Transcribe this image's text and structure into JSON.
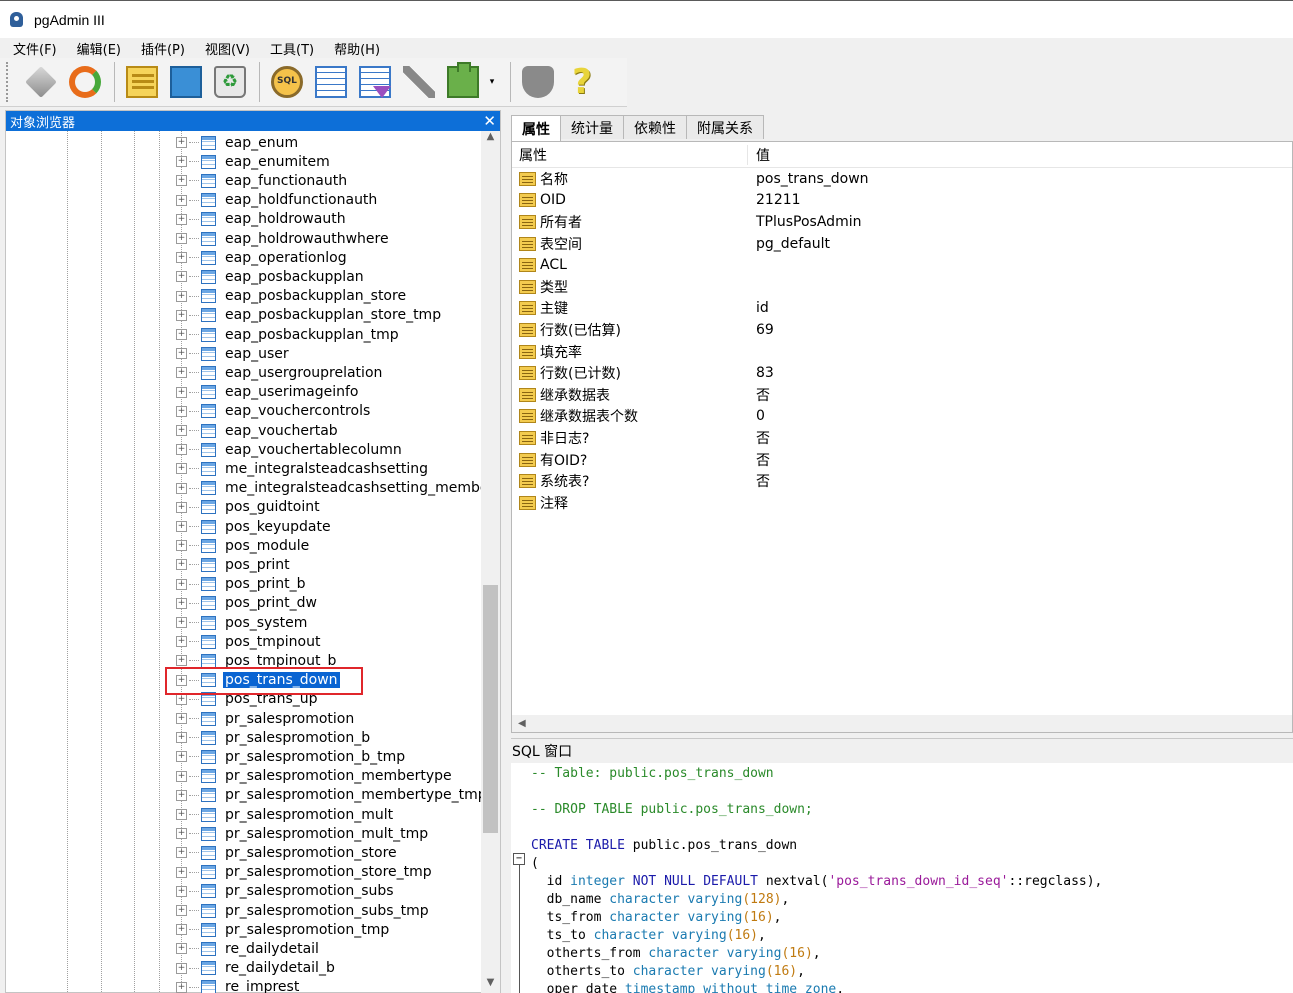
{
  "window": {
    "title": "pgAdmin III"
  },
  "menu": [
    "文件(F)",
    "编辑(E)",
    "插件(P)",
    "视图(V)",
    "工具(T)",
    "帮助(H)"
  ],
  "toolbar": {
    "buttons": [
      "plug-icon",
      "refresh-icon",
      "properties-icon",
      "create-icon",
      "delete-icon",
      "sql-icon",
      "view-data-icon",
      "filter-data-icon",
      "maintenance-icon",
      "plugin-icon",
      "security-icon",
      "help-icon"
    ],
    "help_glyph": "?",
    "dropdown_glyph": "▾"
  },
  "browser": {
    "title": "对象浏览器",
    "close_glyph": "✕",
    "expander_glyph": "+",
    "scroll_up": "▲",
    "scroll_down": "▼",
    "items": [
      "eap_enum",
      "eap_enumitem",
      "eap_functionauth",
      "eap_holdfunctionauth",
      "eap_holdrowauth",
      "eap_holdrowauthwhere",
      "eap_operationlog",
      "eap_posbackupplan",
      "eap_posbackupplan_store",
      "eap_posbackupplan_store_tmp",
      "eap_posbackupplan_tmp",
      "eap_user",
      "eap_usergrouprelation",
      "eap_userimageinfo",
      "eap_vouchercontrols",
      "eap_vouchertab",
      "eap_vouchertablecolumn",
      "me_integralsteadcashsetting",
      "me_integralsteadcashsetting_memberty",
      "pos_guidtoint",
      "pos_keyupdate",
      "pos_module",
      "pos_print",
      "pos_print_b",
      "pos_print_dw",
      "pos_system",
      "pos_tmpinout",
      "pos_tmpinout_b",
      "pos_trans_down",
      "pos_trans_up",
      "pr_salespromotion",
      "pr_salespromotion_b",
      "pr_salespromotion_b_tmp",
      "pr_salespromotion_membertype",
      "pr_salespromotion_membertype_tmp",
      "pr_salespromotion_mult",
      "pr_salespromotion_mult_tmp",
      "pr_salespromotion_store",
      "pr_salespromotion_store_tmp",
      "pr_salespromotion_subs",
      "pr_salespromotion_subs_tmp",
      "pr_salespromotion_tmp",
      "re_dailydetail",
      "re_dailydetail_b",
      "re_imprest"
    ],
    "selected": "pos_trans_down"
  },
  "tabs": [
    "属性",
    "统计量",
    "依赖性",
    "附属关系"
  ],
  "properties": {
    "header_key": "属性",
    "header_value": "值",
    "rows": [
      {
        "key": "名称",
        "value": "pos_trans_down"
      },
      {
        "key": "OID",
        "value": "21211"
      },
      {
        "key": "所有者",
        "value": "TPlusPosAdmin"
      },
      {
        "key": "表空间",
        "value": "pg_default"
      },
      {
        "key": "ACL",
        "value": ""
      },
      {
        "key": "类型",
        "value": ""
      },
      {
        "key": "主键",
        "value": "id"
      },
      {
        "key": "行数(已估算)",
        "value": "69"
      },
      {
        "key": "填充率",
        "value": ""
      },
      {
        "key": "行数(已计数)",
        "value": "83"
      },
      {
        "key": "继承数据表",
        "value": "否"
      },
      {
        "key": "继承数据表个数",
        "value": "0"
      },
      {
        "key": "非日志?",
        "value": "否"
      },
      {
        "key": "有OID?",
        "value": "否"
      },
      {
        "key": "系统表?",
        "value": "否"
      },
      {
        "key": "注释",
        "value": ""
      }
    ],
    "scroll_left": "◀"
  },
  "sql": {
    "title": "SQL 窗口",
    "fold_glyph": "−",
    "lines": {
      "l1": "-- Table: public.pos_trans_down",
      "l2": "-- DROP TABLE public.pos_trans_down;",
      "l3_kw": "CREATE TABLE",
      "l3_rest": " public.pos_trans_down",
      "l4": "(",
      "id_name": "  id ",
      "id_type": "integer",
      "id_kw": " NOT NULL DEFAULT",
      "id_fn": " nextval(",
      "id_str": "'pos_trans_down_id_seq'",
      "id_end": "::regclass),",
      "db_name": "  db_name ",
      "type_cv": "character varying",
      "n128": "(128)",
      "comma": ",",
      "ts_from": "  ts_from ",
      "n16": "(16)",
      "ts_to": "  ts_to ",
      "otherts_from": "  otherts_from ",
      "otherts_to": "  otherts_to ",
      "oper_date": "  oper_date ",
      "type_ts": "timestamp without time zone",
      "trail": ","
    }
  }
}
